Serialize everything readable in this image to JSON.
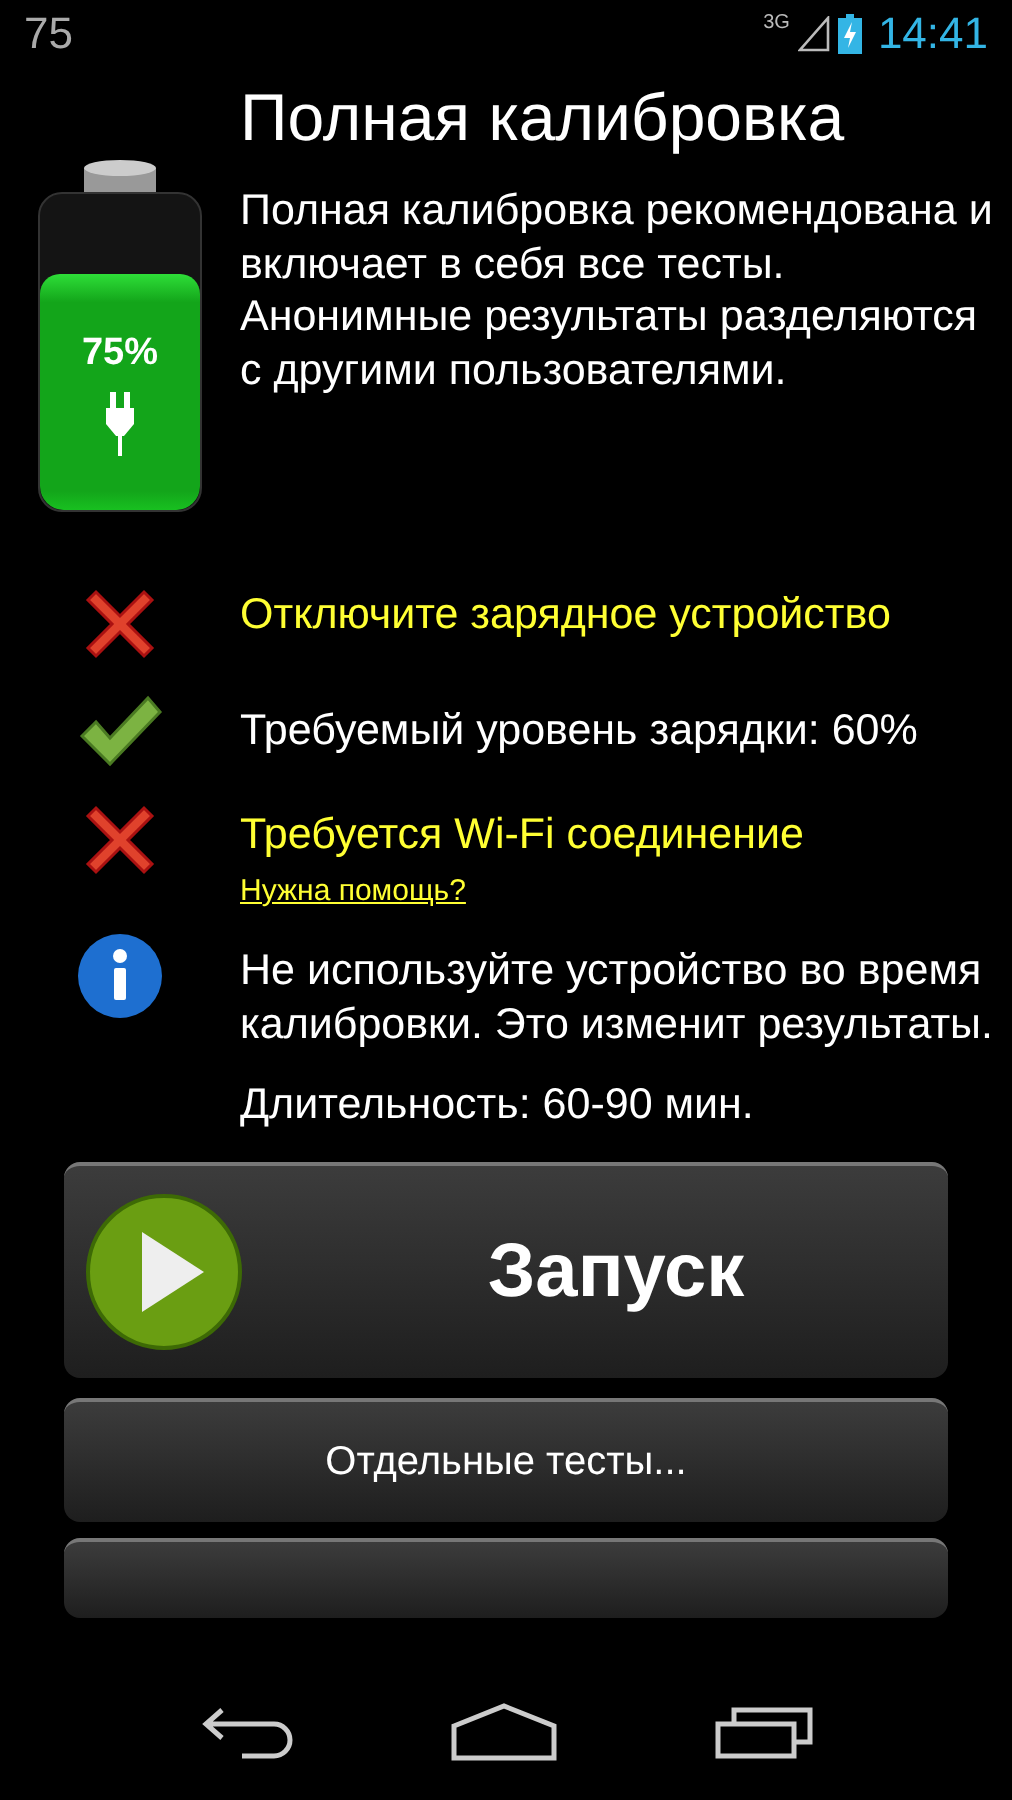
{
  "status_bar": {
    "notification": "75",
    "network": "3G",
    "time": "14:41"
  },
  "battery": {
    "label": "75%",
    "level": 0.75,
    "charging": true
  },
  "title": "Полная калибровка",
  "description": "Полная калибровка рекомендована и включает в себя все тесты. Анонимные результаты разделяются с другими пользователями.",
  "checks": [
    {
      "kind": "fail",
      "text": "Отключите зарядное устройство"
    },
    {
      "kind": "pass",
      "text": "Требуемый уровень зарядки: 60%"
    },
    {
      "kind": "fail",
      "text": "Требуется Wi-Fi соединение",
      "link": "Нужна помощь?"
    },
    {
      "kind": "info",
      "text": "Не используйте устройство во время калибровки. Это изменит результаты."
    }
  ],
  "duration": "Длительность: 60-90 мин.",
  "start_button": {
    "label": "Запуск"
  },
  "tests_button": {
    "label": "Отдельные тесты..."
  }
}
